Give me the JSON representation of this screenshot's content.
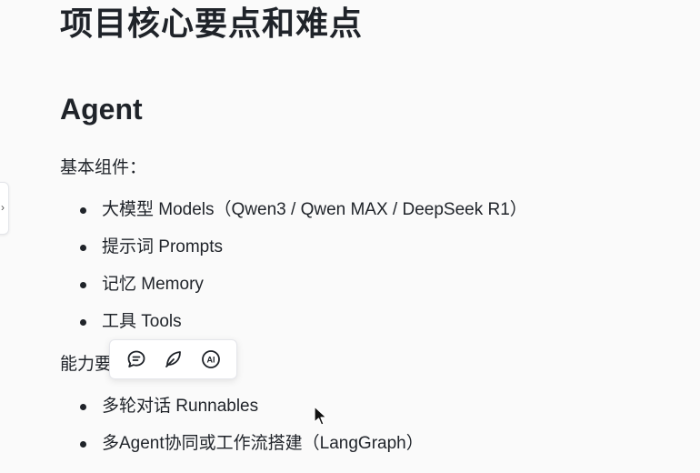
{
  "doc": {
    "title": "项目核心要点和难点",
    "section_heading": "Agent",
    "components_label": "基本组件：",
    "components": [
      "大模型 Models（Qwen3 / Qwen MAX / DeepSeek R1）",
      "提示词 Prompts",
      "记忆 Memory",
      "工具 Tools"
    ],
    "capabilities_label": "能力要点：",
    "capabilities": [
      "多轮对话 Runnables",
      "多Agent协同或工作流搭建（LangGraph）"
    ]
  },
  "toolbar": {
    "buttons": [
      {
        "icon": "comment-icon"
      },
      {
        "icon": "feather-pen-icon"
      },
      {
        "icon": "ai-icon",
        "text": "AI"
      }
    ]
  },
  "side_tab": {
    "icon": "chevron-right-icon",
    "glyph": "›"
  }
}
